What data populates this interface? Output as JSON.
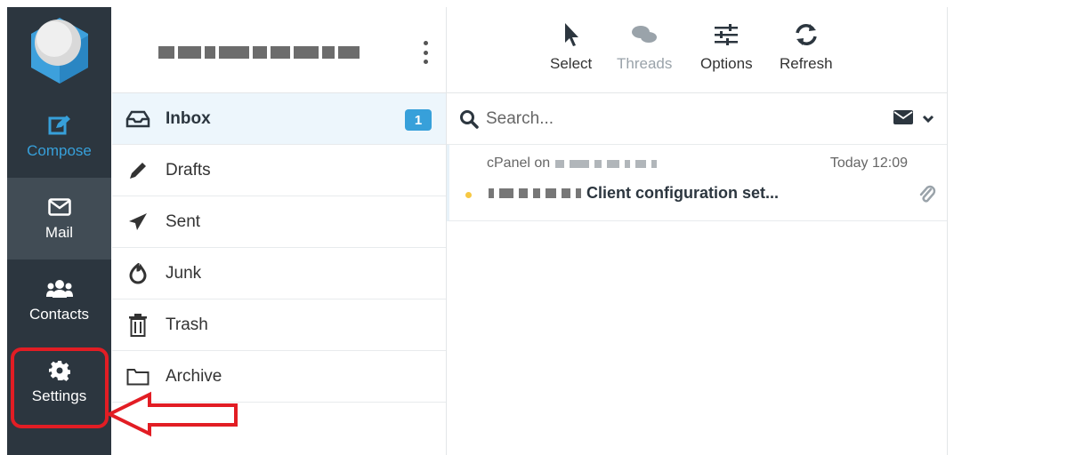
{
  "nav": {
    "compose_label": "Compose",
    "mail_label": "Mail",
    "contacts_label": "Contacts",
    "settings_label": "Settings",
    "accent_color": "#37a0da",
    "rail_color": "#2c363f"
  },
  "folders": {
    "items": [
      {
        "label": "Inbox",
        "icon": "inbox-icon",
        "count": "1",
        "active": true
      },
      {
        "label": "Drafts",
        "icon": "pencil-icon"
      },
      {
        "label": "Sent",
        "icon": "paper-plane-icon"
      },
      {
        "label": "Junk",
        "icon": "fire-icon"
      },
      {
        "label": "Trash",
        "icon": "trash-icon"
      },
      {
        "label": "Archive",
        "icon": "folder-icon"
      }
    ]
  },
  "toolbar": {
    "select_label": "Select",
    "threads_label": "Threads",
    "options_label": "Options",
    "refresh_label": "Refresh"
  },
  "search": {
    "placeholder": "Search..."
  },
  "messages": [
    {
      "from_prefix": "cPanel on",
      "date": "Today 12:09",
      "subject": "Client configuration set...",
      "unread": true,
      "has_attachment": true
    }
  ],
  "annotation": {
    "highlight_color": "#e21d24"
  }
}
